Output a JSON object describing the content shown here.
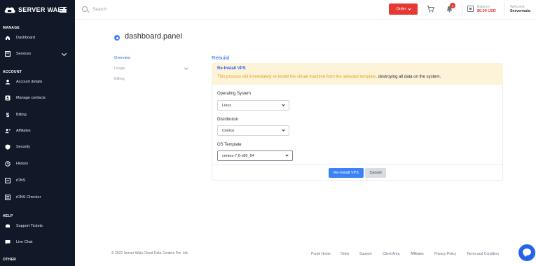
{
  "brand": {
    "name": "SERVER WALA"
  },
  "sidebar": {
    "sections": [
      "MANAGE",
      "ACCOUNT",
      "HELP",
      "OTHER"
    ],
    "items": [
      {
        "label": "Dashboard",
        "icon": "home-icon"
      },
      {
        "label": "Services",
        "icon": "server-icon"
      },
      {
        "label": "Account details",
        "icon": "user-icon"
      },
      {
        "label": "Manage contacts",
        "icon": "contacts-icon"
      },
      {
        "label": "Billing",
        "icon": "dollar-icon"
      },
      {
        "label": "Affiliates",
        "icon": "user-plus-icon"
      },
      {
        "label": "Security",
        "icon": "shield-icon"
      },
      {
        "label": "History",
        "icon": "history-icon"
      },
      {
        "label": "rDNS",
        "icon": "rdns-icon"
      },
      {
        "label": "rDNS Checker",
        "icon": "checker-icon"
      },
      {
        "label": "Support Tickets",
        "icon": "ticket-icon"
      },
      {
        "label": "Live Chat",
        "icon": "chat-icon"
      }
    ]
  },
  "topbar": {
    "search_placeholder": "Search",
    "order_label": "Order",
    "notification_count": "1",
    "balance_label": "Balance",
    "balance_value": "$0.00 USD",
    "welcome_label": "Welcome",
    "username": "Serverwala"
  },
  "page": {
    "title": "dashboard.panel",
    "submenu": [
      "Overview",
      "Usage",
      "Billing"
    ],
    "section_title": "Rebuild"
  },
  "alert": {
    "title": "Re-Install VPS",
    "text_warning": "This process will immediately re-install the virtual machine from the selected template,",
    "text_emphasis": " destroying all data on the system."
  },
  "form": {
    "os_label": "Operating System",
    "os_value": "Linux",
    "distribution_label": "Distribution",
    "distribution_value": "Centos",
    "template_label": "OS Template",
    "template_value": "centos-7.6-x86_64",
    "submit_label": "Re-Install VPS",
    "cancel_label": "Cancel"
  },
  "footer": {
    "copyright": "© 2022 Server Wala Cloud Data Centers Pvt. Ltd.",
    "links": [
      "Portal Home",
      "Order",
      "Support",
      "Client Area",
      "Affiliates",
      "Privacy Policy",
      "Terms and Condition"
    ]
  },
  "colors": {
    "sidebar_bg": "#111827",
    "accent": "#3b82f6",
    "danger": "#e53935",
    "alert_bg": "#fdf3d8",
    "alert_text": "#e0a31b"
  }
}
